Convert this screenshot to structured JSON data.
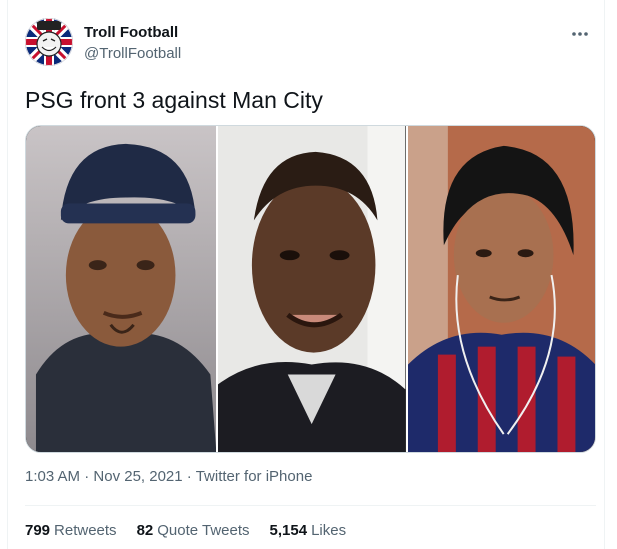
{
  "tweet": {
    "author": {
      "display_name": "Troll Football",
      "handle": "@TrollFootball",
      "avatar_icon": "troll-face-union-jack-avatar"
    },
    "more_icon": "more-dots-icon",
    "text": "PSG front 3 against Man City",
    "media": [
      {
        "icon": "man-in-beanie-photo"
      },
      {
        "icon": "smiling-man-photo"
      },
      {
        "icon": "man-with-earphones-photo"
      }
    ],
    "meta": {
      "time": "1:03 AM",
      "separator": "·",
      "date": "Nov 25, 2021",
      "source": "Twitter for iPhone"
    },
    "stats": {
      "retweets_count": "799",
      "retweets_label": "Retweets",
      "quotes_count": "82",
      "quotes_label": "Quote Tweets",
      "likes_count": "5,154",
      "likes_label": "Likes"
    }
  },
  "colors": {
    "text_primary": "#0f1419",
    "text_secondary": "#536471",
    "border": "#eff3f4"
  }
}
